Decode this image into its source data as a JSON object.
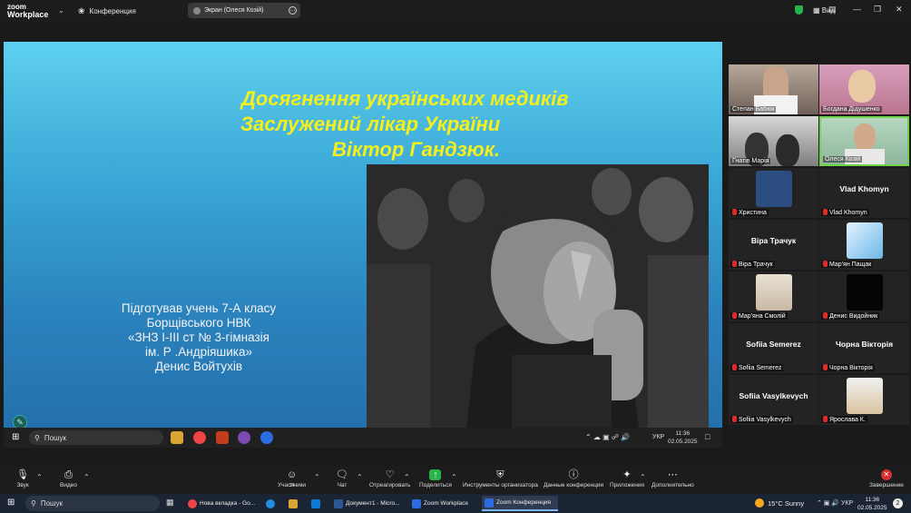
{
  "zoom_top": {
    "logo_line1": "zoom",
    "logo_line2": "Workplace",
    "conference_label": "Конференция",
    "share_pill": "Экран (Олеся Козій)",
    "view_label": "Вид"
  },
  "slide": {
    "title_line1": "Досягнення українських медиків",
    "title_line2": "Заслужений лікар України",
    "title_line3": "Віктор Гандзюк.",
    "sub_lines": [
      "Підготував учень 7-А  класу",
      "Борщівського НВК",
      "«ЗНЗ  І-ІІІ ст № 3-гімназія",
      "ім. Р .Андріяшика»",
      "Денис Войтухів"
    ]
  },
  "remote_taskbar": {
    "search": "Пошук",
    "time": "11:36",
    "date": "02.05.2025",
    "lang": "УКР"
  },
  "gallery": {
    "video_tiles": [
      {
        "name": "Степан Бабюк"
      },
      {
        "name": "Богдана Дідушенко"
      },
      {
        "name": "Гнатів Марія"
      },
      {
        "name": "Олеся Козій"
      }
    ],
    "participants": [
      {
        "name": "Христина",
        "big": ""
      },
      {
        "name": "Vlad Khomyn",
        "big": "Vlad Khomyn"
      },
      {
        "name": "Віра Трачук",
        "big": "Віра Трачук"
      },
      {
        "name": "Мар'ян Пащак",
        "big": ""
      },
      {
        "name": "Мар'яна Смолій",
        "big": ""
      },
      {
        "name": "Денис Видойник",
        "big": ""
      },
      {
        "name": "Sofiia Semerez",
        "big": "Sofiia Semerez"
      },
      {
        "name": "Чорна Вікторія",
        "big": "Чорна Вікторія"
      },
      {
        "name": "Sofiia Vasylkevych",
        "big": "Sofiia Vasylkevych"
      },
      {
        "name": "Ярослава К.",
        "big": ""
      }
    ]
  },
  "toolbar": {
    "audio": "Звук",
    "video": "Видео",
    "participants": "Участники",
    "participants_count": "14",
    "chat": "Чат",
    "react": "Отреагировать",
    "share": "Поделиться",
    "host_tools": "Инструменты организатора",
    "meeting_info": "Данные конференции",
    "apps": "Приложения",
    "more": "Дополнительно",
    "end": "Завершение"
  },
  "local_taskbar": {
    "search": "Пошук",
    "apps": [
      "Нова вкладка - Go...",
      "Документ1 - Micro...",
      "Zoom Workplace",
      "Zoom Конференция"
    ],
    "weather": "15°C  Sunny",
    "lang": "УКР",
    "time": "11:36",
    "date": "02.05.2025",
    "notif_count": "2"
  },
  "colors": {
    "title_yellow": "#f5ef1a",
    "end_red": "#d62f2f",
    "active_border": "#6fd34a"
  }
}
